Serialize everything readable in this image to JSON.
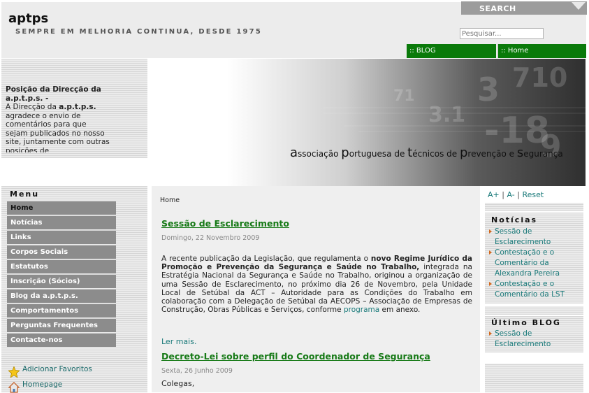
{
  "header": {
    "site_title": "aptps",
    "tagline": "SEMPRE EM MELHORIA CONTINUA, DESDE 1975",
    "search_tab": "SEARCH",
    "search_placeholder": "Pesquisar...",
    "nav": [
      "BLOG",
      "Home"
    ]
  },
  "news_box": {
    "title": "Posição da Direcção da a.p.t.p.s. -",
    "body_prefix": "A Direcção da ",
    "body_bold": "a.p.t.p.s.",
    "body_suffix": " agradece o envio de comentários para que sejam publicados no nosso site, juntamente com outras posições de"
  },
  "banner": {
    "text_parts": [
      {
        "big": "a",
        "rest": "ssociação "
      },
      {
        "big": "p",
        "rest": "ortuguesa de "
      },
      {
        "big": "t",
        "rest": "écnicos de "
      },
      {
        "big": "p",
        "rest": "revenção e "
      },
      {
        "big": "s",
        "rest": "egurança"
      }
    ]
  },
  "menu": {
    "title": "Menu",
    "items": [
      "Home",
      "Notícias",
      "Links",
      "Corpos Sociais",
      "Estatutos",
      "Inscrição (Sócios)",
      "Blog da a.p.t.p.s.",
      "Comportamentos",
      "Perguntas Frequentes",
      "Contacte-nos"
    ]
  },
  "extras": {
    "favorites": "Adicionar Favoritos",
    "homepage": "Homepage"
  },
  "content": {
    "breadcrumb": "Home",
    "post1": {
      "title": "Sessão de Esclarecimento",
      "date": "Domingo, 22 Novembro 2009",
      "p1": "A recente publicação da Legislação, que regulamenta o ",
      "b1": "novo Regime Jurídico da Promoção e Prevenção da Segurança e Saúde no Trabalho,",
      "p2": " integrada na Estratégia Nacional da Segurança e Saúde no Trabalho, originou a organização de uma Sessão de Esclarecimento, no próximo dia 26 de Novembro, pela Unidade Local de Setúbal da ACT – Autoridade para as Condições do Trabalho em colaboração com a Delegação de Setúbal da AECOPS – Associação de Empresas de Construção, Obras Públicas e Serviços, conforme ",
      "link": "programa",
      "p3": " em anexo.",
      "read_more": "Ler mais."
    },
    "post2": {
      "title": "Decreto-Lei sobre perfil do Coordenador de Segurança",
      "date": "Sexta, 26 Junho 2009",
      "body": "Colegas,"
    }
  },
  "right": {
    "font_up": "A+",
    "font_down": "A-",
    "font_reset": "Reset",
    "noticias_title": "Notícias",
    "noticias": [
      "Sessão de Esclarecimento",
      "Contestação e o Comentário da Alexandra Pereira",
      "Contestação e o Comentário da LST"
    ],
    "blog_title": "Último BLOG",
    "blog": [
      "Sessão de Esclarecimento"
    ]
  },
  "colors": {
    "nav_green": "#0a7a0a",
    "link_teal": "#1a7a7a",
    "title_green": "#177a17",
    "menu_grey": "#8c8c8c"
  }
}
